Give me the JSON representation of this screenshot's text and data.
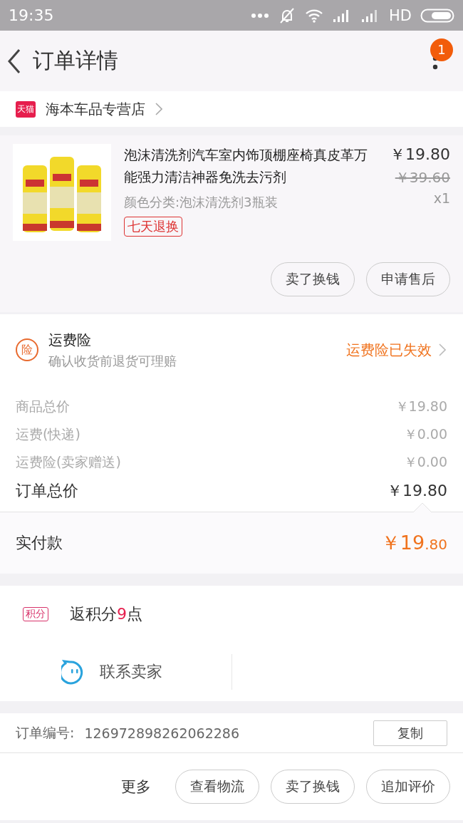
{
  "status_bar": {
    "time": "19:35",
    "network": "HD"
  },
  "header": {
    "title": "订单详情",
    "badge": "1"
  },
  "shop": {
    "logo": "天猫",
    "name": "海本车品专营店"
  },
  "product": {
    "title": "泡沫清洗剂汽车室内饰顶棚座椅真皮革万能强力清洁神器免洗去污剂",
    "price": "￥19.80",
    "original_price": "￥39.60",
    "quantity": "x1",
    "variant": "颜色分类:泡沫清洗剂3瓶装",
    "tag": "七天退换",
    "buttons": [
      "卖了换钱",
      "申请售后"
    ]
  },
  "insurance": {
    "icon": "险",
    "title": "运费险",
    "subtitle": "确认收货前退货可理赔",
    "status": "运费险已失效"
  },
  "price_rows": [
    {
      "kind": "minor",
      "label": "商品总价",
      "value": "￥19.80"
    },
    {
      "kind": "minor",
      "label": "运费(快递)",
      "value": "￥0.00"
    },
    {
      "kind": "minor",
      "label": "运费险(卖家赠送)",
      "value": "￥0.00"
    },
    {
      "kind": "total",
      "label": "订单总价",
      "value": "￥19.80"
    }
  ],
  "paid": {
    "label": "实付款",
    "amount": "￥19",
    "decimals": ".80"
  },
  "points": {
    "badge": "积分",
    "prefix": "返积分",
    "value": "9",
    "suffix": "点"
  },
  "contact": {
    "label": "联系卖家"
  },
  "order": {
    "label": "订单编号:",
    "number": "126972898262062286",
    "copy": "复制"
  },
  "bottom_bar": {
    "more": "更多",
    "buttons": [
      "查看物流",
      "卖了换钱",
      "追加评价"
    ]
  }
}
